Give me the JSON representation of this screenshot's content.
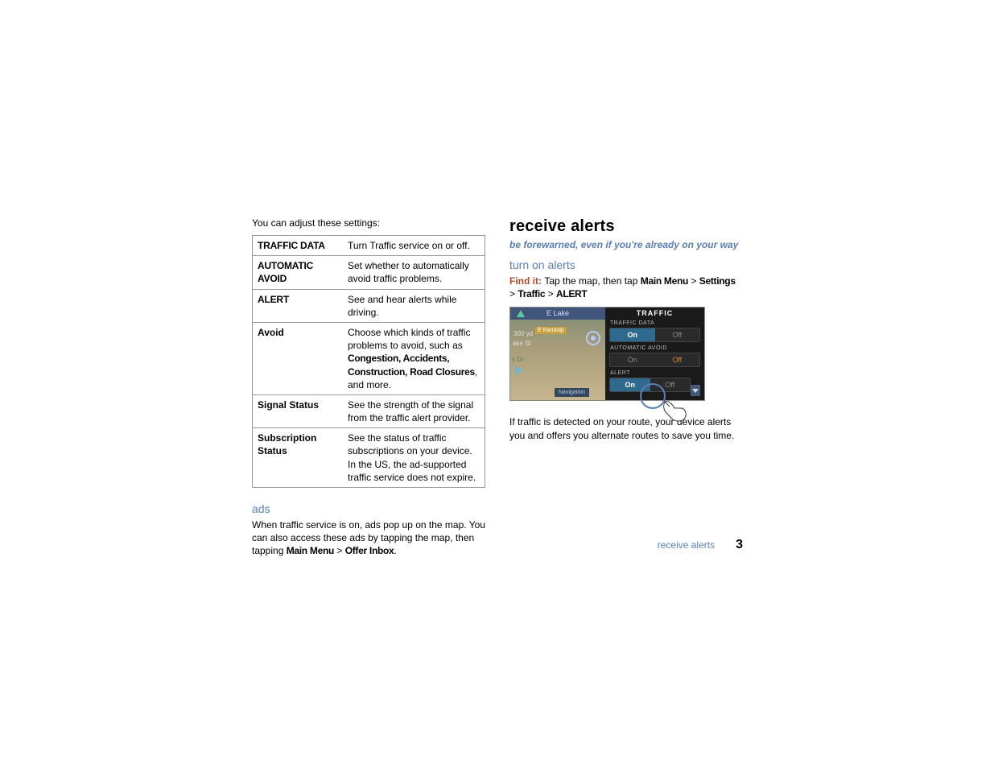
{
  "left": {
    "intro": "You can adjust these settings:",
    "table": [
      {
        "label": "TRAFFIC DATA",
        "caps": true,
        "desc_plain": "Turn Traffic service on or off."
      },
      {
        "label": "AUTOMATIC AVOID",
        "caps": true,
        "desc_plain": "Set whether to automatically avoid traffic problems."
      },
      {
        "label": "ALERT",
        "caps": true,
        "desc_plain": "See and hear alerts while driving."
      },
      {
        "label": "Avoid",
        "caps": false,
        "desc_pre": "Choose which kinds of traffic problems to avoid, such as ",
        "desc_bold": "Congestion, Accidents, Construction, Road Closures",
        "desc_post": ", and more."
      },
      {
        "label": "Signal Status",
        "caps": false,
        "desc_plain": "See the strength of the signal from the traffic alert provider."
      },
      {
        "label": "Subscription Status",
        "caps": false,
        "desc_plain": "See the status of traffic subscriptions on your device. In the US, the ad-supported traffic service does not expire."
      }
    ],
    "ads": {
      "heading": "ads",
      "body": "When traffic service is on, ads pop up on the map. You can also access these ads by tapping the map, then tapping ",
      "path_main": "Main Menu",
      "path_sep": " > ",
      "path_offer": "Offer Inbox",
      "path_end": "."
    }
  },
  "right": {
    "title": "receive alerts",
    "subtitle": "be forewarned, even if you're already on your way",
    "turn_on": {
      "heading": "turn on alerts",
      "findit_lead": "Find it: ",
      "findit_pre": "Tap the map, then tap ",
      "p_main": "Main Menu",
      "sep": " > ",
      "p_settings": "Settings",
      "p_traffic": "Traffic",
      "p_alert": "ALERT"
    },
    "device": {
      "map_top": "E Lake",
      "distance": "300 yd",
      "lake": "ake St",
      "street_sign": "E Randolp",
      "s_dr": "s Dr",
      "nav": "Navigation",
      "panel_title": "TRAFFIC",
      "rows": [
        {
          "label": "TRAFFIC DATA",
          "on": "On",
          "off": "Off",
          "selected": "on"
        },
        {
          "label": "AUTOMATIC AVOID",
          "on": "On",
          "off": "Off",
          "selected": "off"
        },
        {
          "label": "ALERT",
          "on": "On",
          "off": "Off",
          "selected": "on"
        }
      ]
    },
    "outro": "If traffic is detected on your route, your device alerts you and offers you alternate routes to save you time."
  },
  "footer": {
    "section": "receive alerts",
    "page": "3"
  }
}
